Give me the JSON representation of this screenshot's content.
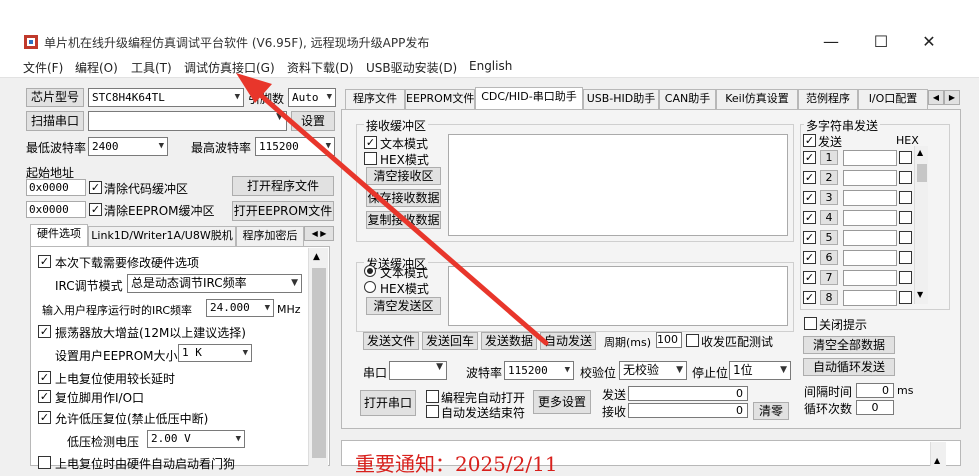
{
  "window": {
    "title": "单片机在线升级编程仿真调试平台软件 (V6.95F), 远程现场升级APP发布",
    "minimize": "—",
    "maximize": "☐",
    "close": "✕"
  },
  "menu": [
    "文件(F)",
    "编程(O)",
    "工具(T)",
    "调试仿真接口(G)",
    "资料下载(D)",
    "USB驱动安装(D)",
    "English"
  ],
  "left": {
    "chip_label": "芯片型号",
    "chip_value": "STC8H4K64TL",
    "pin_label": "引脚数",
    "pin_value": "Auto",
    "scan_port": "扫描串口",
    "settings": "设置",
    "min_baud_label": "最低波特率",
    "min_baud": "2400",
    "max_baud_label": "最高波特率",
    "max_baud": "115200",
    "start_addr_label": "起始地址",
    "addr1": "0x0000",
    "clear_code": "清除代码缓冲区",
    "open_prog": "打开程序文件",
    "addr2": "0x0000",
    "clear_eeprom": "清除EEPROM缓冲区",
    "open_eeprom": "打开EEPROM文件",
    "tabs": [
      "硬件选项",
      "Link1D/Writer1A/U8W脱机",
      "程序加密后"
    ],
    "opt1": "本次下载需要修改硬件选项",
    "irc_mode_label": "IRC调节模式",
    "irc_mode": "总是动态调节IRC频率",
    "irc_freq_label": "输入用户程序运行时的IRC频率",
    "irc_freq": "24.000",
    "mhz": "MHz",
    "opt2": "振荡器放大增益(12M以上建议选择)",
    "eeprom_size_label": "设置用户EEPROM大小",
    "eeprom_size": "1 K",
    "opt3": "上电复位使用较长延时",
    "opt4": "复位脚用作I/O口",
    "opt5": "允许低压复位(禁止低压中断)",
    "lv_label": "低压检测电压",
    "lv_value": "2.00 V",
    "opt6": "上电复位时由硬件自动启动看门狗"
  },
  "right": {
    "tabs": [
      "程序文件",
      "EEPROM文件",
      "CDC/HID-串口助手",
      "USB-HID助手",
      "CAN助手",
      "Keil仿真设置",
      "范例程序",
      "I/O口配置"
    ],
    "recv": {
      "title": "接收缓冲区",
      "text_mode": "文本模式",
      "hex_mode": "HEX模式",
      "clear": "清空接收区",
      "save": "保存接收数据",
      "copy": "复制接收数据"
    },
    "send": {
      "title": "发送缓冲区",
      "text_mode": "文本模式",
      "hex_mode": "HEX模式",
      "clear": "清空发送区"
    },
    "send_file": "发送文件",
    "send_back": "发送回车",
    "send_data": "发送数据",
    "auto_send": "自动发送",
    "period_label": "周期(ms)",
    "period": "100",
    "match": "收发匹配测试",
    "port_label": "串口",
    "baud_label": "波特率",
    "baud": "115200",
    "parity_label": "校验位",
    "parity": "无校验",
    "stop_label": "停止位",
    "stop": "1位",
    "open_port": "打开串口",
    "auto_open": "编程完自动打开",
    "auto_send_end": "自动发送结束符",
    "more": "更多设置",
    "sent_label": "发送",
    "sent": "0",
    "recv_label": "接收",
    "recv_count": "0",
    "clear_count": "清零",
    "multi": {
      "title": "多字符串发送",
      "send": "发送",
      "hex": "HEX",
      "rows": [
        "1",
        "2",
        "3",
        "4",
        "5",
        "6",
        "7",
        "8"
      ],
      "close_tip": "关闭提示",
      "clear_all": "清空全部数据",
      "auto_loop": "自动循环发送",
      "interval_label": "间隔时间",
      "interval": "0",
      "ms": "ms",
      "loops_label": "循环次数",
      "loops": "0"
    },
    "notice": "重要通知：2025/2/11"
  },
  "colors": {
    "arrow": "#e8362b",
    "notice": "#d8201c"
  }
}
